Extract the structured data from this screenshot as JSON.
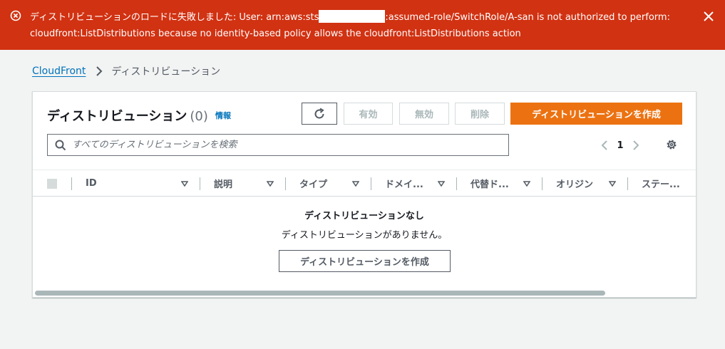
{
  "banner": {
    "message_prefix": "ディストリビューションのロードに失敗しました: User: arn:aws:sts",
    "message_suffix": ":assumed-role/SwitchRole/A-san is not authorized to perform: cloudfront:ListDistributions because no identity-based policy allows the cloudfront:ListDistributions action",
    "color": "#d13212"
  },
  "breadcrumb": {
    "root": "CloudFront",
    "current": "ディストリビューション"
  },
  "header": {
    "title": "ディストリビューション",
    "count": "(0)",
    "info": "情報"
  },
  "actions": {
    "enable": "有効",
    "disable": "無効",
    "delete": "削除",
    "create": "ディストリビューションを作成",
    "accent": "#ec7211"
  },
  "search": {
    "placeholder": "すべてのディストリビューションを検索"
  },
  "pagination": {
    "page": "1"
  },
  "table": {
    "columns": [
      "ID",
      "説明",
      "タイプ",
      "ドメイ...",
      "代替ド...",
      "オリジン",
      "ステー..."
    ]
  },
  "empty": {
    "title": "ディストリビューションなし",
    "description": "ディストリビューションがありません。",
    "button": "ディストリビューションを作成"
  }
}
